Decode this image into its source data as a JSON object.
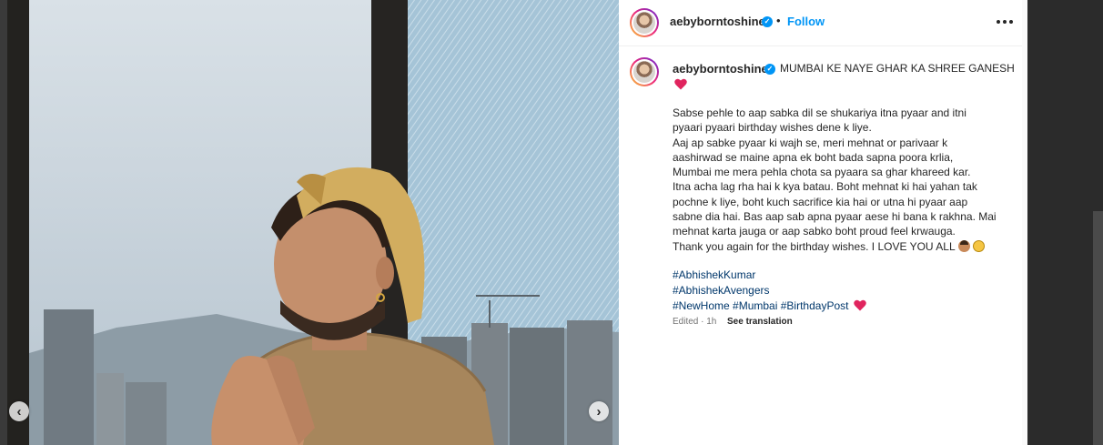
{
  "post": {
    "username": "aebyborntoshine",
    "separator": "•",
    "follow_label": "Follow",
    "caption_title": "MUMBAI KE NAYE GHAR KA SHREE GANESH",
    "caption_body": "Sabse pehle to aap sabka dil se shukariya itna pyaar and itni\npyaari pyaari birthday wishes dene k liye.\nAaj ap sabke pyaar ki wajh se, meri mehnat or parivaar k\naashirwad se maine apna ek boht bada sapna poora krlia,\nMumbai me mera pehla chota sa pyaara sa ghar khareed kar.\nItna acha lag rha hai k kya batau. Boht mehnat ki hai yahan tak\npochne k liye, boht kuch sacrifice kia hai or utna hi pyaar aap\nsabne dia hai. Bas aap sab apna pyaar aese hi bana k rakhna. Mai\nmehnat karta jauga or aap sabko boht proud feel krwauga.\nThank you again for the birthday wishes. I LOVE YOU ALL",
    "hashtags": [
      "#AbhishekKumar",
      "#AbhishekAvengers",
      "#NewHome",
      "#Mumbai",
      "#BirthdayPost"
    ],
    "edited_label": "Edited · 1h",
    "see_translation": "See translation"
  },
  "carousel": {
    "prev_icon": "‹",
    "next_icon": "›"
  },
  "icons": {
    "verified": "verified-badge-icon",
    "more": "more-options-icon",
    "heart": "red-heart-emoji",
    "emoji_1": "person-bowing-emoji",
    "emoji_2": "pleading-face-emoji"
  },
  "colors": {
    "link": "#0095f6",
    "hashtag": "#00376b",
    "heart": "#e0245e",
    "text": "#262626",
    "muted": "#737373"
  }
}
